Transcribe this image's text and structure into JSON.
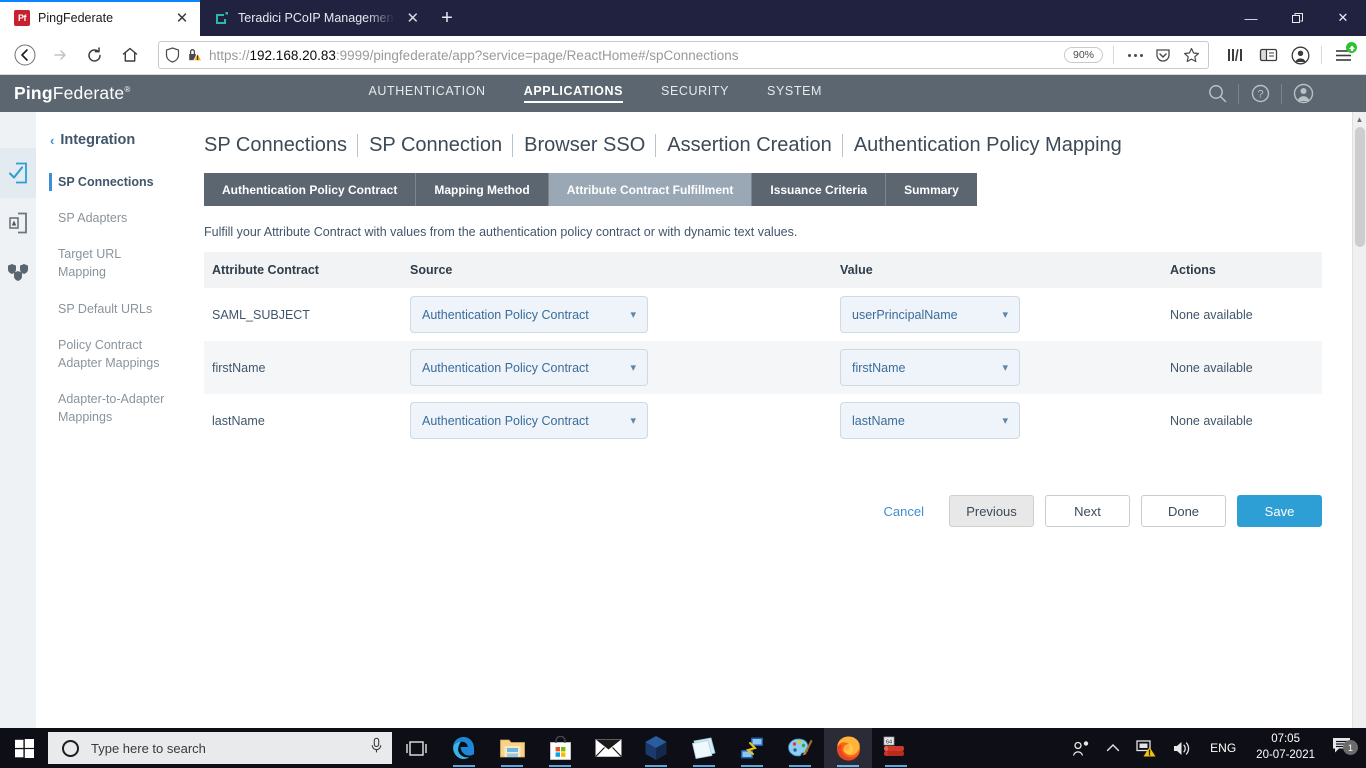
{
  "browser": {
    "tabs": [
      {
        "title": "PingFederate",
        "favicon": "pingfederate-icon",
        "active": true
      },
      {
        "title": "Teradici PCoIP Management Co",
        "favicon": "teradici-icon",
        "active": false
      }
    ],
    "new_tab_label": "+",
    "close_label": "✕",
    "window_controls": {
      "minimize": "—",
      "maximize": "❐",
      "close": "✕"
    },
    "url": {
      "scheme": "https://",
      "host": "192.168.20.83",
      "rest": ":9999/pingfederate/app?service=page/ReactHome#/spConnections",
      "full": "https://192.168.20.83:9999/pingfederate/app?service=page/ReactHome#/spConnections",
      "zoom_level": "90%"
    }
  },
  "app": {
    "brand_bold": "Ping",
    "brand_light": "Federate",
    "brand_mark": "®",
    "nav": [
      {
        "label": "AUTHENTICATION",
        "active": false
      },
      {
        "label": "APPLICATIONS",
        "active": true
      },
      {
        "label": "SECURITY",
        "active": false
      },
      {
        "label": "SYSTEM",
        "active": false
      }
    ]
  },
  "sidebar": {
    "section_label": "Integration",
    "items": [
      {
        "label": "SP Connections",
        "active": true
      },
      {
        "label": "SP Adapters",
        "active": false
      },
      {
        "label": "Target URL Mapping",
        "active": false
      },
      {
        "label": "SP Default URLs",
        "active": false
      },
      {
        "label": "Policy Contract Adapter Mappings",
        "active": false
      },
      {
        "label": "Adapter-to-Adapter Mappings",
        "active": false
      }
    ]
  },
  "breadcrumb": [
    "SP Connections",
    "SP Connection",
    "Browser SSO",
    "Assertion Creation",
    "Authentication Policy Mapping"
  ],
  "tabs": [
    {
      "label": "Authentication Policy Contract",
      "active": false
    },
    {
      "label": "Mapping Method",
      "active": false
    },
    {
      "label": "Attribute Contract Fulfillment",
      "active": true
    },
    {
      "label": "Issuance Criteria",
      "active": false
    },
    {
      "label": "Summary",
      "active": false
    }
  ],
  "main": {
    "instruction": "Fulfill your Attribute Contract with values from the authentication policy contract or with dynamic text values.",
    "table": {
      "headers": [
        "Attribute Contract",
        "Source",
        "Value",
        "Actions"
      ],
      "rows": [
        {
          "attribute": "SAML_SUBJECT",
          "source": "Authentication Policy Contract",
          "value": "userPrincipalName",
          "actions": "None available"
        },
        {
          "attribute": "firstName",
          "source": "Authentication Policy Contract",
          "value": "firstName",
          "actions": "None available"
        },
        {
          "attribute": "lastName",
          "source": "Authentication Policy Contract",
          "value": "lastName",
          "actions": "None available"
        }
      ]
    },
    "buttons": {
      "cancel": "Cancel",
      "previous": "Previous",
      "next": "Next",
      "done": "Done",
      "save": "Save"
    }
  },
  "taskbar": {
    "search_placeholder": "Type here to search",
    "apps": [
      {
        "name": "microsoft-edge",
        "open": true,
        "active": false
      },
      {
        "name": "file-explorer",
        "open": true,
        "active": false
      },
      {
        "name": "microsoft-store",
        "open": true,
        "active": false
      },
      {
        "name": "mail",
        "open": false,
        "active": false
      },
      {
        "name": "virtualbox",
        "open": true,
        "active": false
      },
      {
        "name": "sticky-notes",
        "open": true,
        "active": false
      },
      {
        "name": "network-tool",
        "open": true,
        "active": false
      },
      {
        "name": "paint",
        "open": true,
        "active": false
      },
      {
        "name": "firefox",
        "open": true,
        "active": true
      },
      {
        "name": "winrar",
        "open": true,
        "active": false
      }
    ],
    "language": "ENG",
    "time": "07:05",
    "date": "20-07-2021",
    "notification_count": "1"
  },
  "colors": {
    "accent_blue": "#2e9fd4",
    "header_grey": "#5b6670",
    "tab_active_grey": "#9aa8b5",
    "link_blue": "#3d8fd1",
    "titlebar_navy": "#21223f"
  }
}
